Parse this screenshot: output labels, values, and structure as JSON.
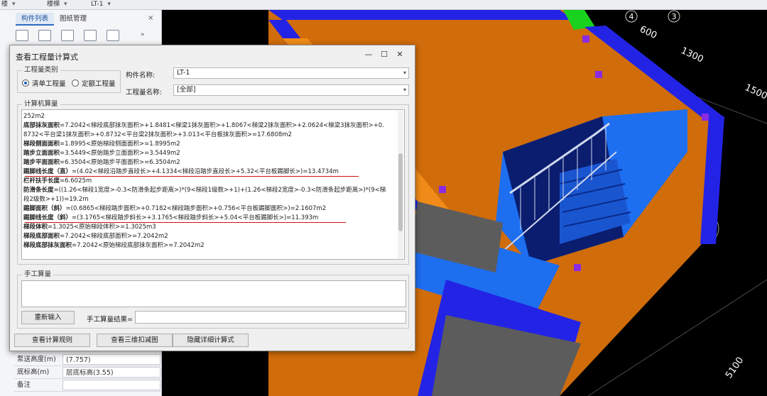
{
  "topbar": {
    "dropdowns": [
      "楼",
      "楼梯",
      "LT-1"
    ]
  },
  "left_panel": {
    "tabs": [
      {
        "label": "构件列表",
        "active": true
      },
      {
        "label": "图纸管理",
        "active": false
      }
    ],
    "close": "×",
    "expand": "»",
    "properties": [
      {
        "key": "泵送高度(m)",
        "value": "(7.757)"
      },
      {
        "key": "底标高(m)",
        "value": "层底标高(3.55)"
      },
      {
        "key": "备注",
        "value": ""
      }
    ]
  },
  "viewport": {
    "axis_labels": [
      "4",
      "3"
    ],
    "dimensions": [
      "600",
      "1300",
      "1500",
      "5100"
    ],
    "colors": {
      "background": "#000000",
      "wall": "#2323e6",
      "slab": "#1e6ef0",
      "side": "#d06c0a",
      "rim": "#f08a18",
      "green_marker": "#19d21e",
      "purple_marker": "#8a2be2"
    }
  },
  "dialog": {
    "title": "查看工程量计算式",
    "window_buttons": {
      "minimize": "—",
      "maximize": "☐",
      "close": "✕"
    },
    "quantity_category": {
      "label": "工程量类别",
      "options": [
        {
          "label": "清单工程量",
          "selected": true
        },
        {
          "label": "定额工程量",
          "selected": false
        }
      ]
    },
    "component_name": {
      "label": "构件名称:",
      "value": "LT-1"
    },
    "quantity_name": {
      "label": "工程量名称:",
      "value": "[全部]"
    },
    "calc_section_label": "计算机算量",
    "calc_lines": [
      {
        "label": "",
        "text": "252m2"
      },
      {
        "label": "底部抹灰面积",
        "text": "=7.2042<梯段底部抹灰面积>+1.8481<梯梁1抹灰面积>+1.8067<梯梁2抹灰面积>+2.0624<梯梁3抹灰面积>+0."
      },
      {
        "label": "",
        "text": "8732<平台梁1抹灰面积>+0.8732<平台梁2抹灰面积>+3.013<平台板抹灰面积>=17.6808m2"
      },
      {
        "label": "梯段侧面面积",
        "text": "=1.8995<原始梯段侧面面积>=1.8995m2"
      },
      {
        "label": "踏步立面面积",
        "text": "=3.5449<原始踏步立面面积>=3.5449m2"
      },
      {
        "label": "踏步平面面积",
        "text": "=6.3504<原始踏步平面面积>=6.3504m2"
      },
      {
        "label": "踢脚线长度（直）",
        "text": "=(4.02<梯段沿踏步直段长>+4.1334<梯段沿踏步直段长>+5.32<平台板踢脚长>)=13.4734m"
      },
      {
        "label": "栏杆扶手长度",
        "text": "=6.6025m"
      },
      {
        "label": "防滑条长度",
        "text": "=((1.26<梯段1宽度>-0.3<防滑条起步距离>)*(9<梯段1级数>+1)+(1.26<梯段2宽度>-0.3<防滑条起步距离>)*(9<梯"
      },
      {
        "label": "",
        "text": "段2级数>+1))=19.2m"
      },
      {
        "label": "踢脚面积（斜）",
        "text": "=(0.6865<梯段踏步面积>+0.7182<梯段踏步面积>+0.756<平台板踢脚面积>)=2.1607m2"
      },
      {
        "label": "踢脚线长度（斜）",
        "text": "=(3.1765<梯段踏步斜长>+3.1765<梯段踏步斜长>+5.04<平台板踢脚长>)=11.393m"
      },
      {
        "label": "梯段体积",
        "text": "=1.3025<原始梯段体积>=1.3025m3"
      },
      {
        "label": "梯段底部面积",
        "text": "=7.2042<梯段底部面积>=7.2042m2"
      },
      {
        "label": "梯段底部抹灰面积",
        "text": "=7.2042<原始梯段底部抹灰面积>=7.2042m2"
      }
    ],
    "manual_section_label": "手工算量",
    "reenter_button": "重新输入",
    "manual_result_label": "手工算量结果=",
    "buttons": {
      "view_rules": "查看计算规则",
      "view_3d": "查看三维扣减图",
      "hide_details": "隐藏详细计算式"
    }
  }
}
